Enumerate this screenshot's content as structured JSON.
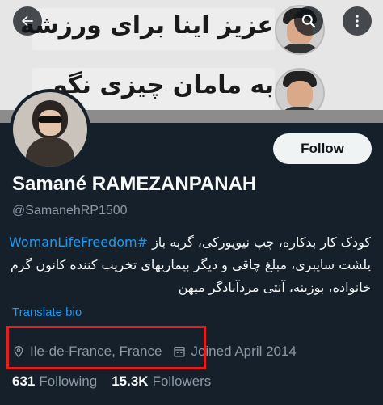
{
  "banner": {
    "line1": "عزیز اینا برای ورزشه",
    "line2": "به مامان چیزی نگو"
  },
  "nav": {
    "back_icon": "arrow-left-icon",
    "search_icon": "search-icon",
    "more_icon": "more-vertical-icon"
  },
  "profile": {
    "name": "Samané RAMEZANPANAH",
    "handle": "@SamanehRP1500",
    "follow_label": "Follow",
    "bio_line1_text": "کودک کار بدکاره، چپ نیویورکی، گربه باز",
    "bio_hashtag": "#WomanLifeFreedom",
    "bio_line2": "پلشت سایبری، مبلغ چاقی و دیگر بیماریهای تخریب کننده کانون گرم",
    "bio_line3": "خانواده، بوزینه، آنتی مردآبادگر میهن",
    "translate_label": "Translate bio",
    "location": "Ile-de-France, France",
    "joined": "Joined April 2014",
    "following_count": "631",
    "following_label": "Following",
    "followers_count": "15.3K",
    "followers_label": "Followers"
  },
  "colors": {
    "background": "#15202b",
    "accent": "#1d9bf0",
    "secondary_text": "#8b98a5",
    "highlight_border": "#e02020"
  }
}
